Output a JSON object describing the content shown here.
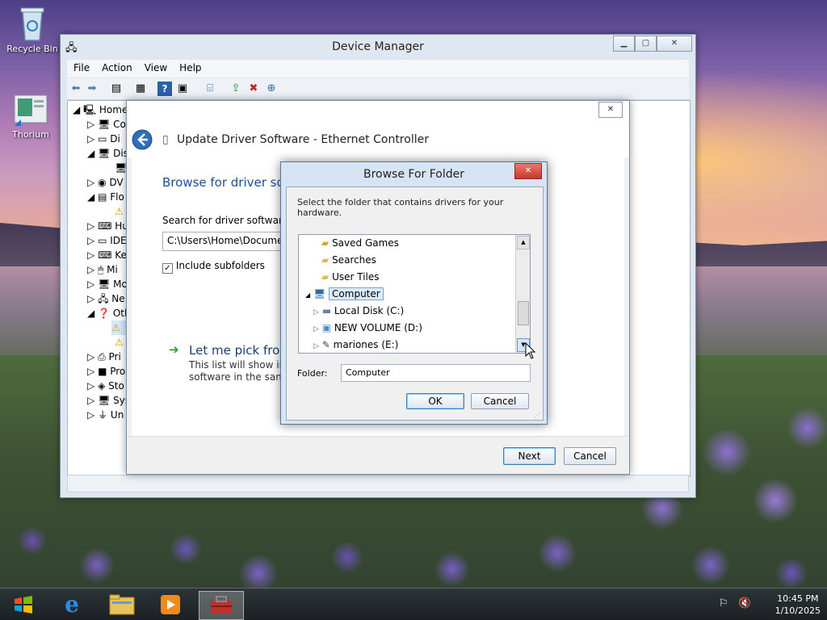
{
  "desktop": {
    "icons": [
      {
        "label": "Recycle Bin",
        "icon": "recycle-bin-icon"
      },
      {
        "label": "Thorium",
        "icon": "thorium-icon"
      }
    ]
  },
  "device_manager": {
    "title": "Device Manager",
    "menu": [
      "File",
      "Action",
      "View",
      "Help"
    ],
    "tree": [
      {
        "label": "Home",
        "expander": "◢"
      },
      {
        "label": "Co",
        "expander": "▷"
      },
      {
        "label": "Di",
        "expander": "▷"
      },
      {
        "label": "Dis",
        "expander": "◢"
      },
      {
        "label": "DV",
        "expander": "▷"
      },
      {
        "label": "Flo",
        "expander": "◢"
      },
      {
        "label": "Hu",
        "expander": "▷"
      },
      {
        "label": "IDE",
        "expander": "▷"
      },
      {
        "label": "Ke",
        "expander": "▷"
      },
      {
        "label": "Mi",
        "expander": "▷"
      },
      {
        "label": "Mo",
        "expander": "▷"
      },
      {
        "label": "Ne",
        "expander": "▷"
      },
      {
        "label": "Oth",
        "expander": "◢"
      },
      {
        "label": "Pri",
        "expander": "▷"
      },
      {
        "label": "Pro",
        "expander": "▷"
      },
      {
        "label": "Sto",
        "expander": "▷"
      },
      {
        "label": "Sys",
        "expander": "▷"
      },
      {
        "label": "Un",
        "expander": "▷"
      }
    ]
  },
  "update_driver": {
    "title": "Update Driver Software - Ethernet Controller",
    "heading": "Browse for driver sof",
    "search_label": "Search for driver software in",
    "path_value": "C:\\Users\\Home\\Document",
    "include_subfolders": "Include subfolders",
    "pick_title": "Let me pick from",
    "pick_desc_1": "This list will show inst",
    "pick_desc_2": "software in the same c",
    "next": "Next",
    "cancel": "Cancel"
  },
  "browse_folder": {
    "title": "Browse For Folder",
    "instruction": "Select the folder that contains drivers for your hardware.",
    "tree": [
      {
        "label": "Saved Games",
        "icon": "saved-games-folder-icon",
        "expander": ""
      },
      {
        "label": "Searches",
        "icon": "folder-icon",
        "expander": ""
      },
      {
        "label": "User Tiles",
        "icon": "folder-icon",
        "expander": ""
      },
      {
        "label": "Computer",
        "icon": "computer-icon",
        "expander": "◢"
      },
      {
        "label": "Local Disk (C:)",
        "icon": "local-disk-icon",
        "expander": "▷"
      },
      {
        "label": "NEW VOLUME (D:)",
        "icon": "drive-icon",
        "expander": "▷"
      },
      {
        "label": "mariones (E:)",
        "icon": "usb-drive-icon",
        "expander": "▷"
      }
    ],
    "folder_label": "Folder:",
    "folder_value": "Computer",
    "ok": "OK",
    "cancel": "Cancel"
  },
  "taskbar": {
    "apps": [
      "start-button",
      "internet-explorer-icon",
      "file-explorer-icon",
      "media-player-icon",
      "device-manager-task-icon"
    ],
    "time": "10:45 PM",
    "date": "1/10/2025"
  }
}
